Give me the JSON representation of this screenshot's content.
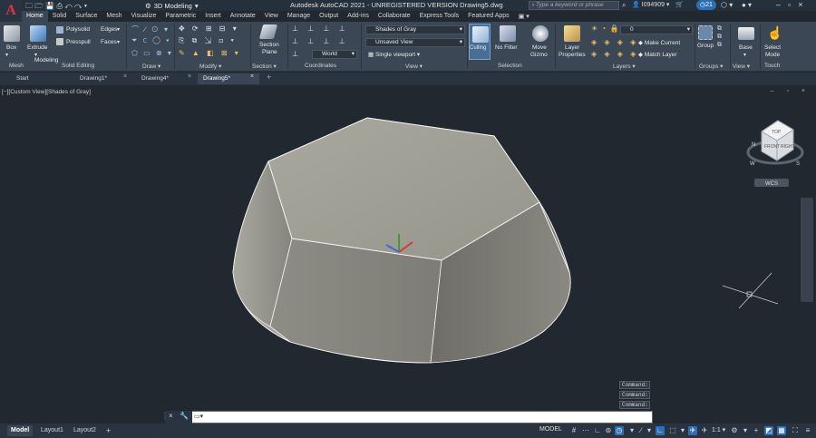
{
  "app": {
    "title": "Autodesk AutoCAD 2021 - UNREGISTERED VERSION    Drawing5.dwg",
    "logo": "A",
    "workspace": "3D Modeling"
  },
  "search": {
    "placeholder": "Type a keyword or phrase"
  },
  "user": {
    "name": "I094909",
    "clock_badge": "21"
  },
  "ribbon_tabs": [
    "Home",
    "Solid",
    "Surface",
    "Mesh",
    "Visualize",
    "Parametric",
    "Insert",
    "Annotate",
    "View",
    "Manage",
    "Output",
    "Add-ins",
    "Collaborate",
    "Express Tools",
    "Featured Apps"
  ],
  "ribbon": {
    "box": "Box",
    "extrude": "Extrude",
    "polysolid": "Polysolid",
    "presspull": "Presspull",
    "edges": "Edges",
    "faces": "Faces",
    "modeling": "Modeling",
    "mesh": "Mesh",
    "solid_editing": "Solid Editing",
    "draw": "Draw",
    "modify": "Modify",
    "section_plane_1": "Section",
    "section_plane_2": "Plane",
    "section": "Section",
    "coordinates": "Coordinates",
    "world": "World",
    "visual_style": "Shades of Gray",
    "saved_view": "Unsaved View",
    "viewport_config": "Single viewport",
    "view": "View",
    "culling": "Culling",
    "no_filter": "No Filter",
    "move_gizmo_1": "Move",
    "move_gizmo_2": "Gizmo",
    "selection": "Selection",
    "layer_properties_1": "Layer",
    "layer_properties_2": "Properties",
    "layer_name": "0",
    "make_current": "Make Current",
    "match_layer": "Match Layer",
    "layers": "Layers",
    "group": "Group",
    "groups": "Groups",
    "base": "Base",
    "view_panel": "View",
    "select_mode_1": "Select",
    "select_mode_2": "Mode",
    "touch": "Touch"
  },
  "doc_tabs": [
    "Start",
    "Drawing1*",
    "Drawing4*",
    "Drawing5*"
  ],
  "viewport": {
    "label": "[−][Custom View][Shades of Gray]",
    "controls": "–  ▫  ×",
    "viewcube_top": "TOP",
    "viewcube_front": "FRONT",
    "viewcube_right": "RIGHT",
    "compass_n": "N",
    "compass_s": "S",
    "compass_w": "W",
    "wcs": "WCS"
  },
  "command": {
    "history": [
      "Command:",
      "Command:",
      "Command:"
    ],
    "placeholder": ""
  },
  "layout_tabs": [
    "Model",
    "Layout1",
    "Layout2"
  ],
  "status": {
    "model": "MODEL",
    "scale": "1:1"
  }
}
